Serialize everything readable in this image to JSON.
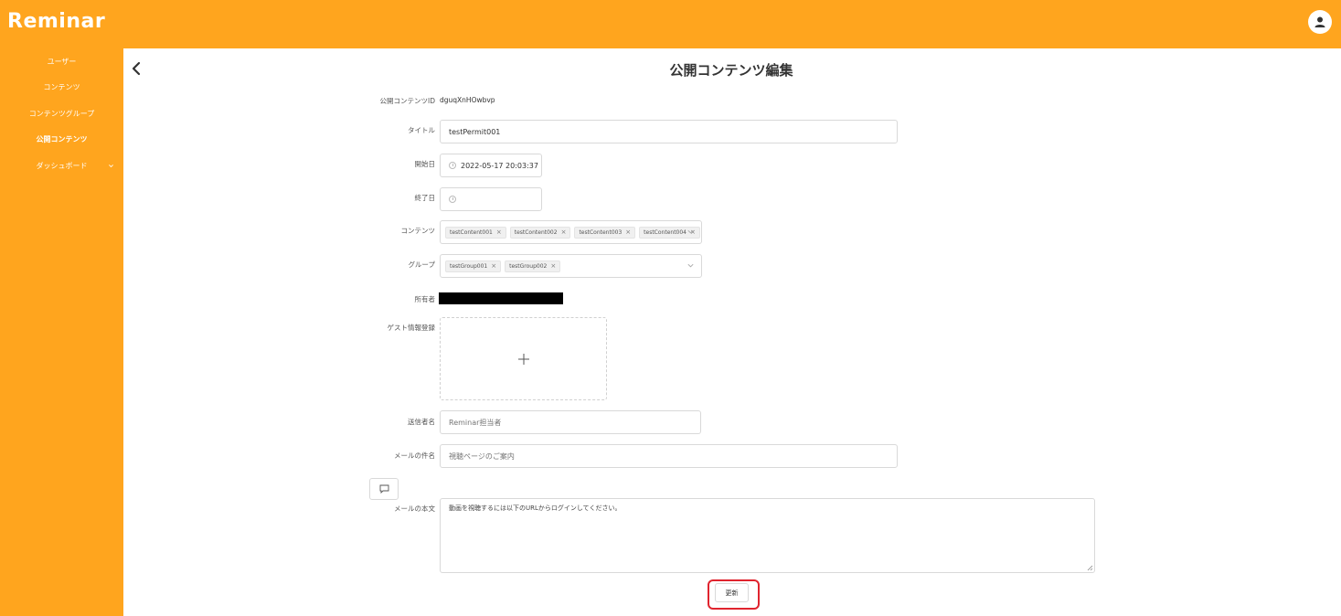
{
  "app": {
    "name": "Reminar"
  },
  "sidebar": {
    "items": [
      {
        "label": "ユーザー"
      },
      {
        "label": "コンテンツ"
      },
      {
        "label": "コンテンツグループ"
      },
      {
        "label": "公開コンテンツ"
      },
      {
        "label": "ダッシュボード"
      }
    ]
  },
  "page": {
    "title": "公開コンテンツ編集"
  },
  "form": {
    "id_label": "公開コンテンツID",
    "id_value": "dguqXnHOwbvp",
    "title_label": "タイトル",
    "title_value": "testPermit001",
    "start_label": "開始日",
    "start_value": "2022-05-17 20:03:37",
    "end_label": "終了日",
    "end_value": "",
    "contents_label": "コンテンツ",
    "contents_tags": [
      "testContent001",
      "testContent002",
      "testContent003",
      "testContent004"
    ],
    "groups_label": "グループ",
    "groups_tags": [
      "testGroup001",
      "testGroup002"
    ],
    "owner_label": "所有者",
    "guest_label": "ゲスト情報登録",
    "sender_label": "送信者名",
    "sender_placeholder": "Reminar担当者",
    "subject_label": "メールの件名",
    "subject_placeholder": "視聴ページのご案内",
    "body_label": "メールの本文",
    "body_value": "動画を視聴するには以下のURLからログインしてください。",
    "update_label": "更新"
  },
  "colors": {
    "brand": "#ffa51e",
    "highlight": "#e0242e"
  },
  "icons": {
    "back": "chevron-left-icon",
    "avatar": "user-icon",
    "upload": "plus-icon",
    "message": "message-icon",
    "clock": "clock-icon",
    "dropdown": "chevron-down-icon"
  }
}
